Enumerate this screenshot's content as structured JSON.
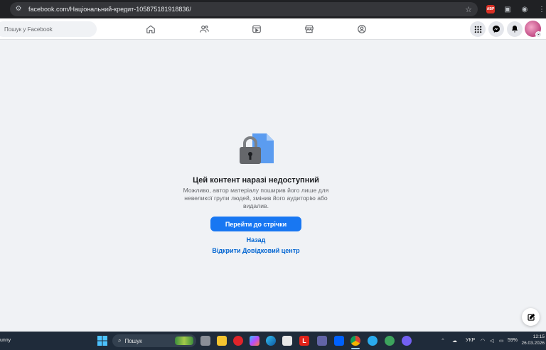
{
  "browser": {
    "url": "facebook.com/Національний-кредит-105875181918836/",
    "abp_label": "ABP"
  },
  "facebook": {
    "search_placeholder": "Пошук у Facebook"
  },
  "content": {
    "title": "Цей контент наразі недоступний",
    "description": "Можливо, автор матеріалу поширив його лише для невеликої групи людей, змінив його аудиторію або видалив.",
    "primary_button": "Перейти до стрічки",
    "back_link": "Назад",
    "help_link": "Відкрити Довідковий центр"
  },
  "taskbar": {
    "weather_text": "unny",
    "search_label": "Пошук",
    "language": "УКР",
    "battery": "59%",
    "time": "12:15",
    "date": "26.03.2026",
    "lnk_letter": "L"
  },
  "colors": {
    "fb_blue": "#1877f2",
    "link_blue": "#0064d1",
    "page_bg": "#f0f2f5"
  }
}
